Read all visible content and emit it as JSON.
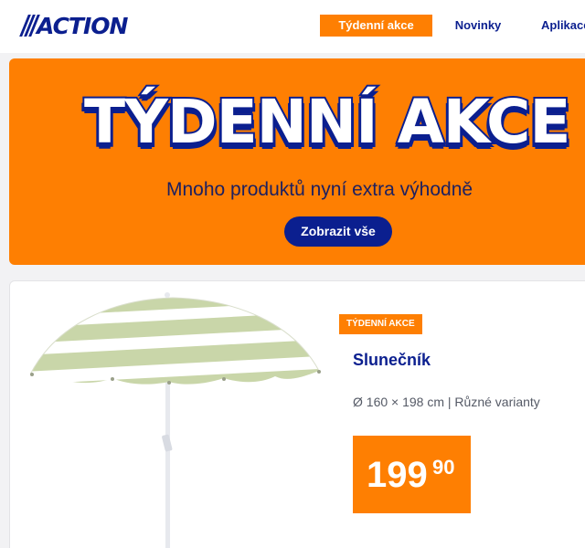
{
  "header": {
    "logo_text": "ACTION",
    "nav": [
      {
        "label": "Týdenní akce",
        "active": true
      },
      {
        "label": "Novinky",
        "active": false
      },
      {
        "label": "Aplikace",
        "active": false
      }
    ]
  },
  "hero": {
    "title": "TÝDENNÍ AKCE",
    "subtitle": "Mnoho produktů nyní extra výhodně",
    "button_label": "Zobrazit vše"
  },
  "product": {
    "badge": "TÝDENNÍ AKCE",
    "name": "Slunečník",
    "meta": "Ø 160 × 198 cm | Různé varianty",
    "price_main": "199",
    "price_cents": "90",
    "image_icon": "beach-umbrella"
  },
  "colors": {
    "brand_blue": "#0b1f8f",
    "brand_orange": "#fe7f02",
    "background": "#f2f2f4"
  }
}
